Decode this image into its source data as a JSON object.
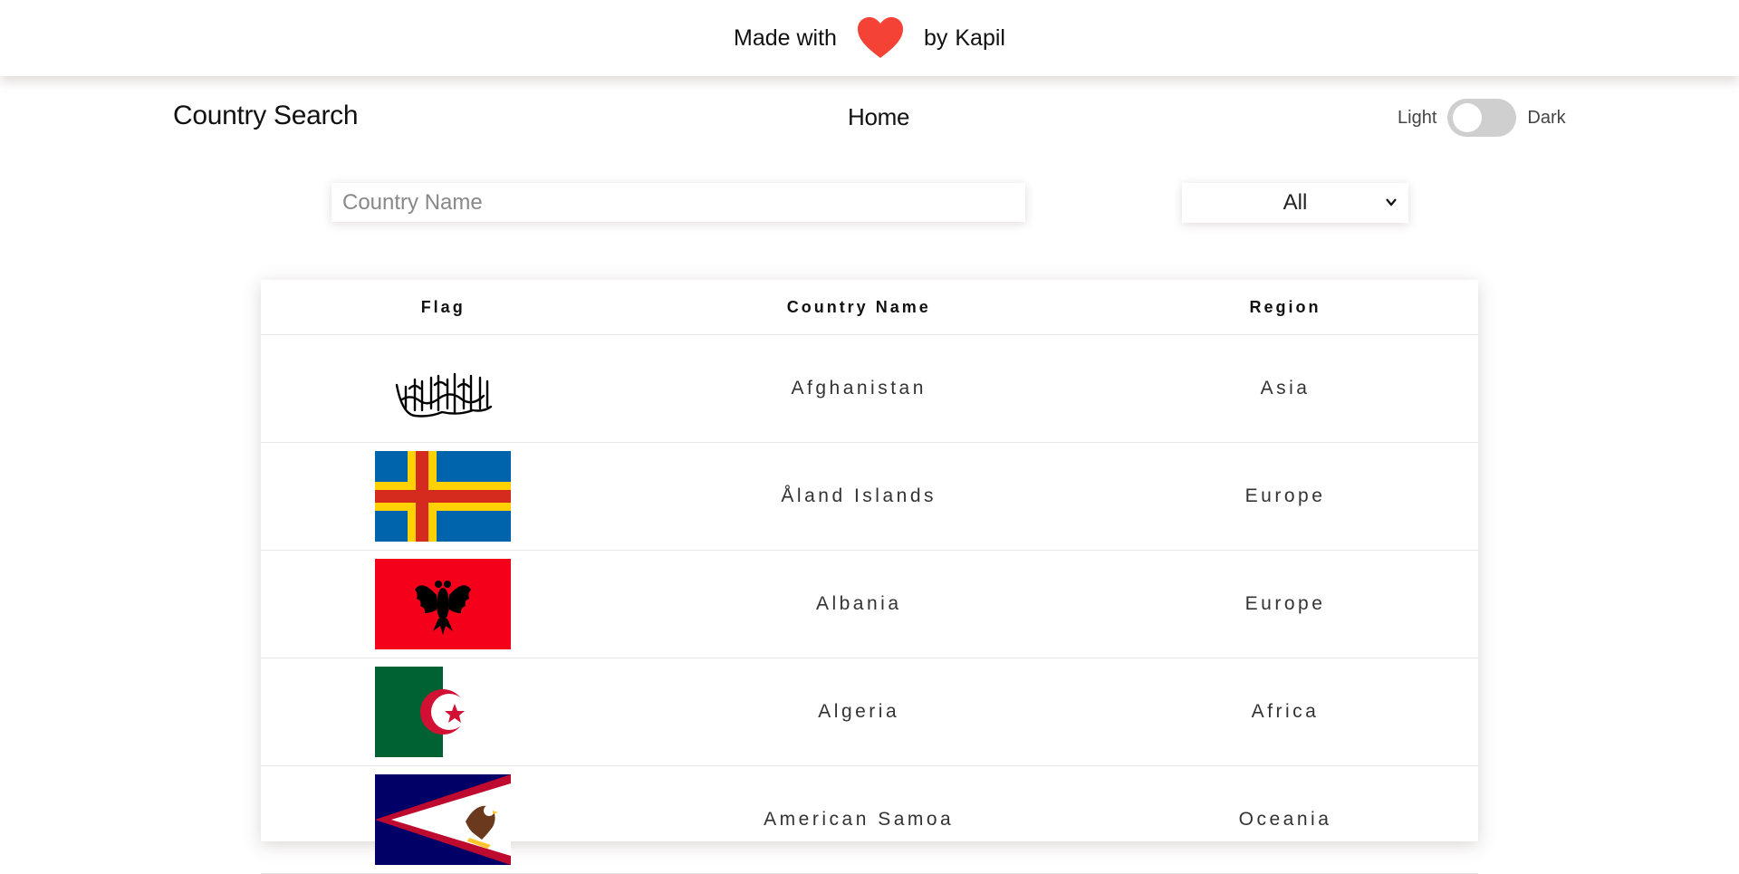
{
  "banner": {
    "made_with": "Made with",
    "by": "by",
    "author": "Kapil",
    "icon": "heart-icon"
  },
  "nav": {
    "brand": "Country Search",
    "home": "Home"
  },
  "theme": {
    "light": "Light",
    "dark": "Dark",
    "is_dark": false
  },
  "search": {
    "placeholder": "Country Name",
    "value": ""
  },
  "filter": {
    "selected": "All"
  },
  "table": {
    "headers": [
      "Flag",
      "Country Name",
      "Region"
    ],
    "rows": [
      {
        "flag": "afghanistan-flag",
        "country": "Afghanistan",
        "region": "Asia"
      },
      {
        "flag": "aland-islands-flag",
        "country": "Åland Islands",
        "region": "Europe"
      },
      {
        "flag": "albania-flag",
        "country": "Albania",
        "region": "Europe"
      },
      {
        "flag": "algeria-flag",
        "country": "Algeria",
        "region": "Africa"
      },
      {
        "flag": "american-samoa-flag",
        "country": "American Samoa",
        "region": "Oceania"
      }
    ]
  },
  "colors": {
    "heart": "#f44336",
    "toggle_track": "#cfcfcf",
    "aland_blue": "#0064ad",
    "aland_yellow": "#ffd100",
    "aland_red": "#d52b1e",
    "albania_red": "#f4001b",
    "algeria_green": "#006233",
    "algeria_red": "#d21034",
    "samoa_blue": "#000066",
    "samoa_red": "#bf0a30"
  }
}
